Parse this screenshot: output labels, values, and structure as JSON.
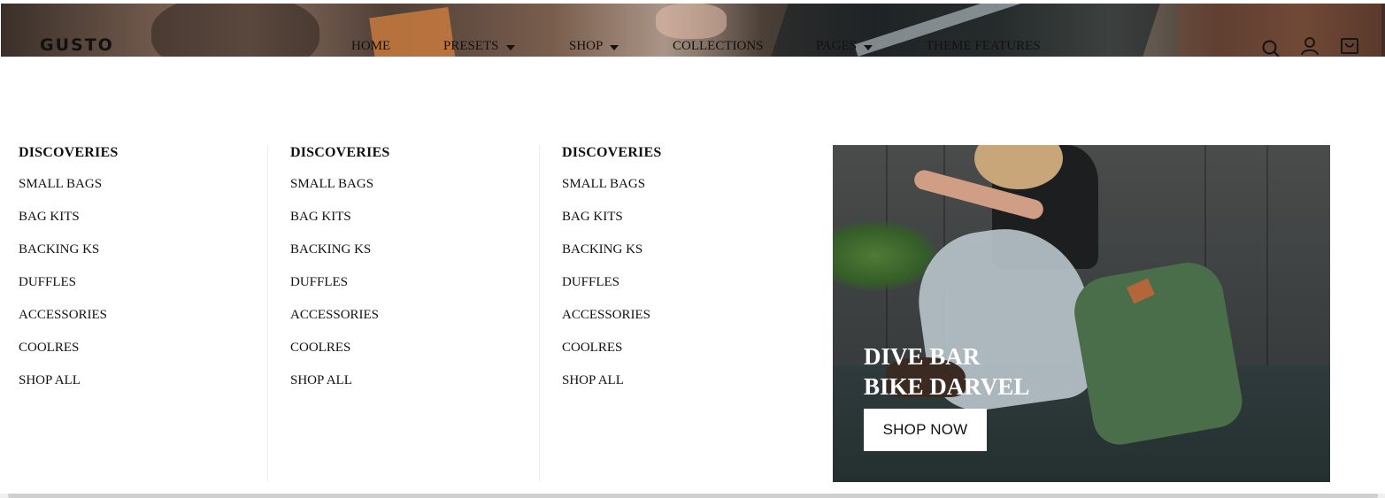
{
  "header": {
    "logo": "GUSTO",
    "nav": [
      {
        "label": "HOME",
        "has_dropdown": false
      },
      {
        "label": "PRESETS",
        "has_dropdown": true
      },
      {
        "label": "SHOP",
        "has_dropdown": true
      },
      {
        "label": "COLLECTIONS",
        "has_dropdown": false
      },
      {
        "label": "PAGES",
        "has_dropdown": true
      },
      {
        "label": "THEME FEATURES",
        "has_dropdown": false
      }
    ],
    "icons": [
      "search-icon",
      "account-icon",
      "cart-icon"
    ]
  },
  "mega_menu": {
    "columns": [
      {
        "title": "DISCOVERIES",
        "links": [
          "SMALL BAGS",
          "BAG KITS",
          "BACKING KS",
          "DUFFLES",
          "ACCESSORIES",
          "COOLRES",
          "SHOP ALL"
        ]
      },
      {
        "title": "DISCOVERIES",
        "links": [
          "SMALL BAGS",
          "BAG KITS",
          "BACKING KS",
          "DUFFLES",
          "ACCESSORIES",
          "COOLRES",
          "SHOP ALL"
        ]
      },
      {
        "title": "DISCOVERIES",
        "links": [
          "SMALL BAGS",
          "BAG KITS",
          "BACKING KS",
          "DUFFLES",
          "ACCESSORIES",
          "COOLRES",
          "SHOP ALL"
        ]
      }
    ],
    "promo": {
      "title_line1": "DIVE BAR",
      "title_line2": "BIKE DARVEL",
      "button_label": "SHOP NOW"
    }
  },
  "colors": {
    "text": "#111111",
    "background": "#ffffff",
    "promo_text": "#ffffff",
    "button_bg": "#ffffff"
  }
}
